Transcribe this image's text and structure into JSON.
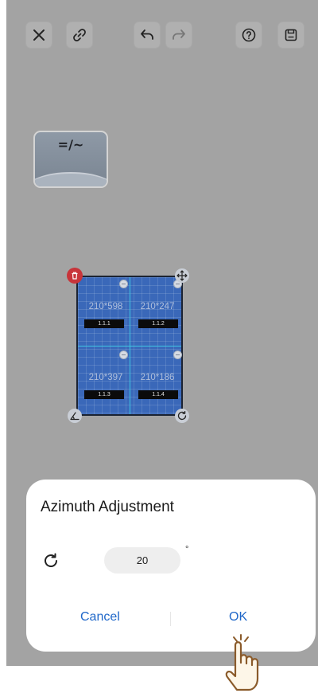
{
  "toolbar": {
    "icons": [
      "close-icon",
      "link-icon",
      "undo-icon",
      "redo-icon",
      "help-icon",
      "save-icon"
    ]
  },
  "inverter": {
    "symbol": "=/~"
  },
  "array": {
    "panels": [
      {
        "size": "210*598",
        "tag": "1.1.1"
      },
      {
        "size": "210*247",
        "tag": "1.1.2"
      },
      {
        "size": "210*397",
        "tag": "1.1.3"
      },
      {
        "size": "210*186",
        "tag": "1.1.4"
      }
    ],
    "colors": {
      "panel": "#3a68b9",
      "delete": "#c8343a"
    }
  },
  "dialog": {
    "title": "Azimuth Adjustment",
    "value": "20",
    "unit": "°",
    "cancel_label": "Cancel",
    "ok_label": "OK",
    "accent_color": "#1f67c9"
  }
}
